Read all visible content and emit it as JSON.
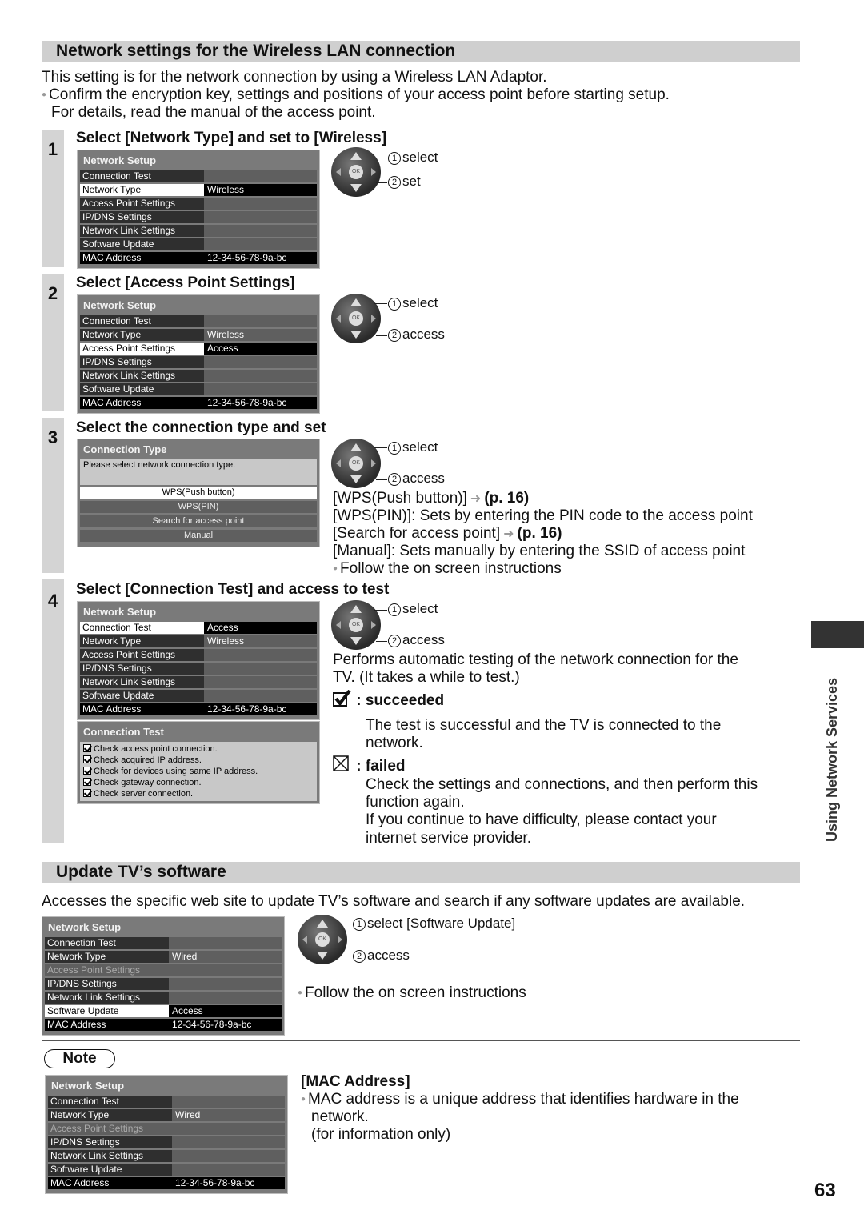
{
  "section1": {
    "title": "Network settings for the Wireless LAN connection",
    "intro": "This setting is for the network connection by using a Wireless LAN Adaptor.",
    "bullet_line1": "Confirm the encryption key, settings and positions of your access point before starting setup.",
    "bullet_line2": "For details, read the manual of the access point."
  },
  "steps": [
    {
      "number": "1",
      "title": "Select [Network Type] and set to [Wireless]",
      "menu": {
        "title": "Network Setup",
        "rows": [
          {
            "label": "Connection Test",
            "value": ""
          },
          {
            "label": "Network Type",
            "value": "Wireless"
          },
          {
            "label": "Access Point Settings",
            "value": ""
          },
          {
            "label": "IP/DNS Settings",
            "value": ""
          },
          {
            "label": "Network Link Settings",
            "value": ""
          },
          {
            "label": "Software Update",
            "value": ""
          },
          {
            "label": "MAC Address",
            "value": "12-34-56-78-9a-bc"
          }
        ]
      },
      "remote": {
        "label1": "select",
        "label2": "set",
        "num1": "1",
        "num2": "2"
      }
    },
    {
      "number": "2",
      "title": "Select [Access Point Settings]",
      "menu": {
        "title": "Network Setup",
        "rows": [
          {
            "label": "Connection Test",
            "value": ""
          },
          {
            "label": "Network Type",
            "value": "Wireless"
          },
          {
            "label": "Access Point Settings",
            "value": "Access"
          },
          {
            "label": "IP/DNS Settings",
            "value": ""
          },
          {
            "label": "Network Link Settings",
            "value": ""
          },
          {
            "label": "Software Update",
            "value": ""
          },
          {
            "label": "MAC Address",
            "value": "12-34-56-78-9a-bc"
          }
        ]
      },
      "remote": {
        "label1": "select",
        "label2": "access",
        "num1": "1",
        "num2": "2"
      }
    },
    {
      "number": "3",
      "title": "Select the connection type and set",
      "menu": {
        "title": "Connection Type",
        "prompt": "Please select network connection type.",
        "options": [
          "WPS(Push button)",
          "WPS(PIN)",
          "Search for access point",
          "Manual"
        ]
      },
      "remote": {
        "label1": "select",
        "label2": "access",
        "num1": "1",
        "num2": "2"
      },
      "descriptions": {
        "wps_push": "[WPS(Push button)]",
        "wps_push_ref": "(p. 16)",
        "wps_pin": "[WPS(PIN)]: Sets by entering the PIN code to the access point",
        "search": "[Search for access point]",
        "search_ref": "(p. 16)",
        "manual": "[Manual]: Sets manually by entering the SSID of access point",
        "follow": "Follow the on screen instructions"
      }
    },
    {
      "number": "4",
      "title": "Select [Connection Test] and access to test",
      "menu": {
        "title": "Network Setup",
        "rows": [
          {
            "label": "Connection Test",
            "value": "Access"
          },
          {
            "label": "Network Type",
            "value": "Wireless"
          },
          {
            "label": "Access Point Settings",
            "value": ""
          },
          {
            "label": "IP/DNS Settings",
            "value": ""
          },
          {
            "label": "Network Link Settings",
            "value": ""
          },
          {
            "label": "Software Update",
            "value": ""
          },
          {
            "label": "MAC Address",
            "value": "12-34-56-78-9a-bc"
          }
        ]
      },
      "test_box": {
        "title": "Connection Test",
        "items": [
          "Check access point connection.",
          "Check acquired IP address.",
          "Check for devices using same IP address.",
          "Check gateway connection.",
          "Check server connection."
        ]
      },
      "remote": {
        "label1": "select",
        "label2": "access",
        "num1": "1",
        "num2": "2"
      },
      "description_line1": "Performs automatic testing of the network connection for the",
      "description_line2": "TV. (It takes a while to test.)",
      "succeeded_label": ": succeeded",
      "succeeded_line1": "The test is successful and the TV is connected to the",
      "succeeded_line2": "network.",
      "failed_label": ": failed",
      "failed_line1": "Check the settings and connections, and then perform this",
      "failed_line2": "function again.",
      "failed_line3": "If you continue to have difficulty, please contact your",
      "failed_line4": "internet service provider."
    }
  ],
  "section2": {
    "title": "Update TV’s software",
    "intro": "Accesses the specific web site to update TV’s software and search if any software updates are available.",
    "menu": {
      "title": "Network Setup",
      "rows": [
        {
          "label": "Connection Test",
          "value": ""
        },
        {
          "label": "Network Type",
          "value": "Wired"
        },
        {
          "label": "Access Point Settings",
          "value": ""
        },
        {
          "label": "IP/DNS Settings",
          "value": ""
        },
        {
          "label": "Network Link Settings",
          "value": ""
        },
        {
          "label": "Software Update",
          "value": "Access"
        },
        {
          "label": "MAC Address",
          "value": "12-34-56-78-9a-bc"
        }
      ]
    },
    "remote": {
      "label1": "select [Software Update]",
      "label2": "access",
      "num1": "1",
      "num2": "2"
    },
    "follow": "Follow the on screen instructions"
  },
  "note": {
    "label": "Note",
    "menu": {
      "title": "Network Setup",
      "rows": [
        {
          "label": "Connection Test",
          "value": ""
        },
        {
          "label": "Network Type",
          "value": "Wired"
        },
        {
          "label": "Access Point Settings",
          "value": ""
        },
        {
          "label": "IP/DNS Settings",
          "value": ""
        },
        {
          "label": "Network Link Settings",
          "value": ""
        },
        {
          "label": "Software Update",
          "value": ""
        },
        {
          "label": "MAC Address",
          "value": "12-34-56-78-9a-bc"
        }
      ]
    },
    "heading": "[MAC Address]",
    "line1": "MAC address is a unique address that identifies hardware in the",
    "line2": "network.",
    "line3": "(for information only)"
  },
  "side_tab": {
    "label": "Using Network Services"
  },
  "page_number": "63"
}
